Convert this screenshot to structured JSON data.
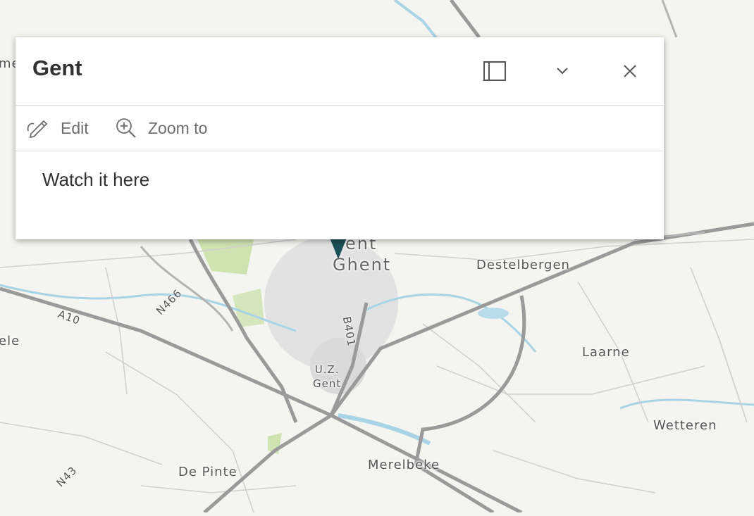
{
  "popup": {
    "title": "Gent",
    "dock_icon": "dock-icon",
    "collapse_icon": "chevron-down-icon",
    "close_icon": "close-icon",
    "actions": [
      {
        "label": "Edit",
        "icon": "edit-pencil-icon"
      },
      {
        "label": "Zoom to",
        "icon": "zoom-in-icon"
      }
    ],
    "content": "Watch it here"
  },
  "map": {
    "places": {
      "ghent_top": "ent",
      "ghent": "Ghent",
      "destelbergen": "Destelbergen",
      "laarne": "Laarne",
      "uz_line1": "U.Z.",
      "uz_line2": "Gent",
      "wetteren": "Wetteren",
      "merelbeke": "Merelbeke",
      "de_pinte": "De Pinte",
      "left_ele": "ele",
      "left_me": "me"
    },
    "roads": {
      "a10": "A10",
      "n466": "N466",
      "b401": "B401",
      "n43": "N43"
    },
    "colors": {
      "background": "#f4f4f0",
      "motorway": "#9a9a9a",
      "water": "#a8d4e6",
      "park": "#cfe3b0",
      "urban": "#dcdcdc"
    }
  }
}
